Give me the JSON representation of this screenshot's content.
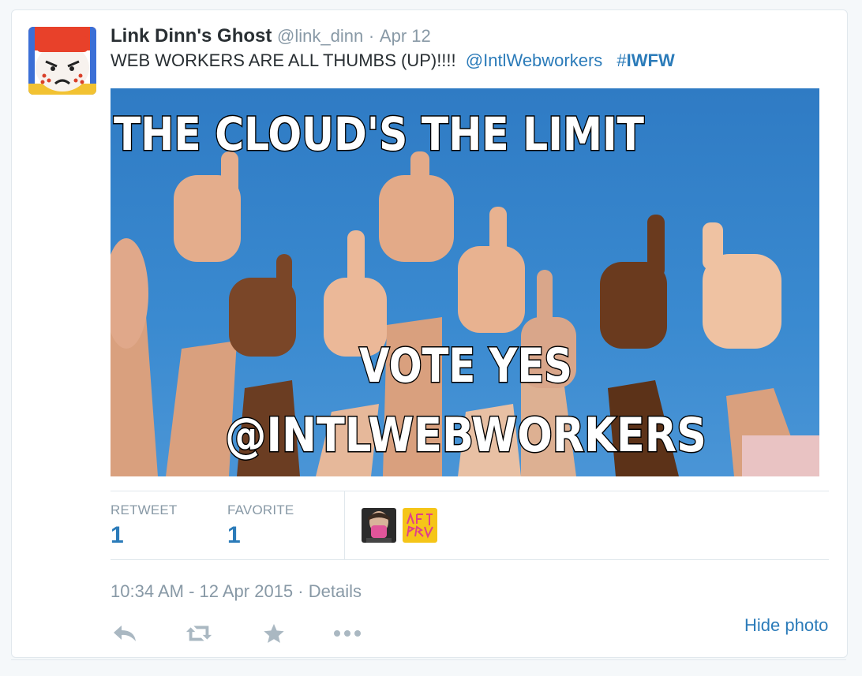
{
  "tweet": {
    "author_name": "Link Dinn's Ghost",
    "author_handle": "@link_dinn",
    "separator": "·",
    "date": "Apr 12",
    "text_main": "WEB WORKERS ARE ALL THUMBS (UP)!!!!",
    "mention": "@IntlWebworkers",
    "hashtag_symbol": "#",
    "hashtag_text": "IWFW"
  },
  "photo": {
    "line1": "THE CLOUD'S THE LIMIT",
    "line2": "VOTE YES",
    "line3": "@INTLWEBWORKERS",
    "sky_color": "#3a87cf",
    "skin_light": "#e8b090",
    "skin_dark": "#7a4a2a"
  },
  "stats": {
    "retweet_label": "RETWEET",
    "retweet_count": "1",
    "favorite_label": "FAVORITE",
    "favorite_count": "1"
  },
  "meta": {
    "timestamp": "10:34 AM - 12 Apr 2015",
    "separator": "·",
    "details_link": "Details"
  },
  "actions": {
    "reply_icon": "reply-icon",
    "retweet_icon": "retweet-icon",
    "favorite_icon": "star-icon",
    "more_icon": "more-icon",
    "hide_photo_label": "Hide photo"
  },
  "colors": {
    "link": "#2b7bb9",
    "muted": "#8899a6",
    "text": "#292f33",
    "border": "#e1e8ed",
    "icon": "#aab8c2"
  }
}
